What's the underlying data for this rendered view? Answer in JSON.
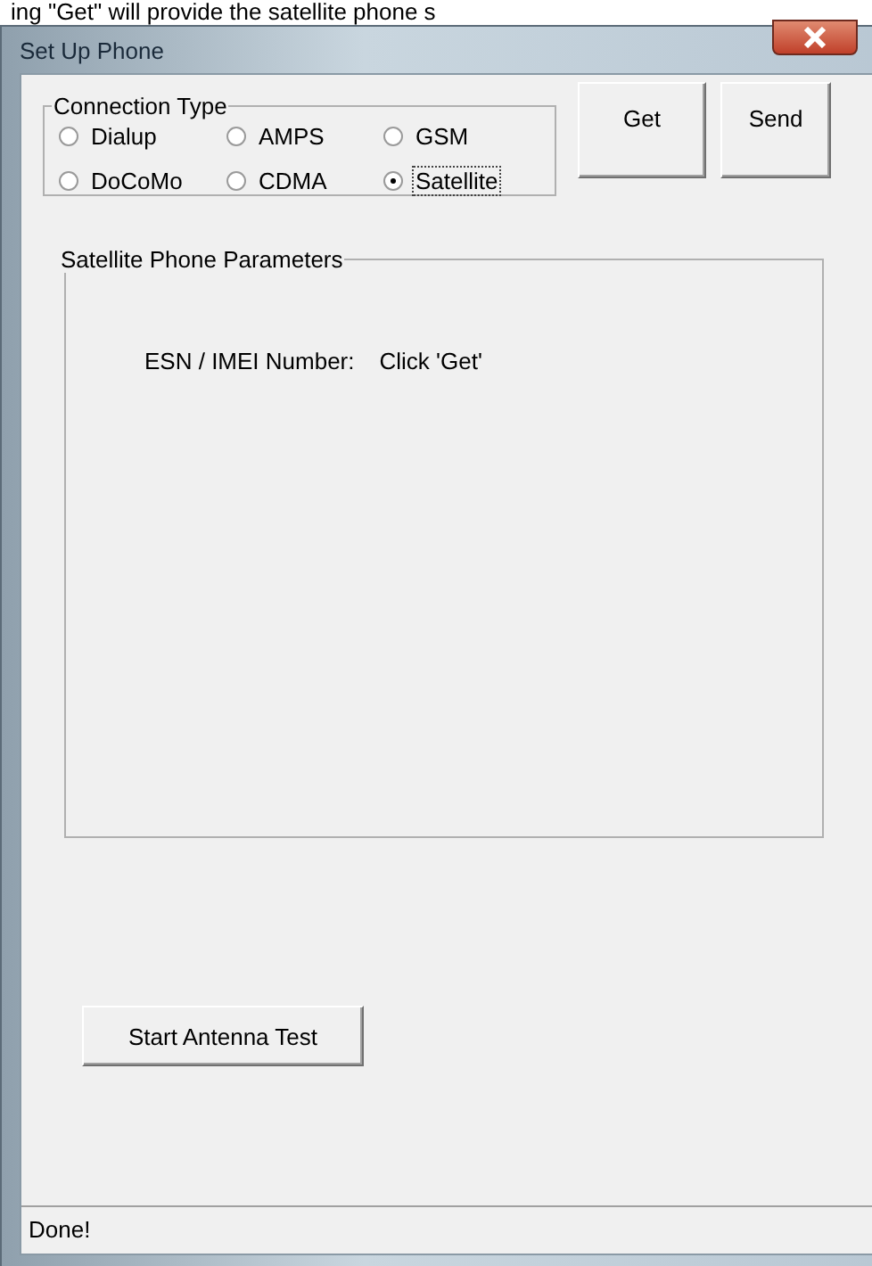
{
  "caption": "ing \"Get\" will provide the satellite phone s",
  "window": {
    "title": "Set Up Phone"
  },
  "connection_type": {
    "label": "Connection Type",
    "options": [
      {
        "label": "Dialup",
        "selected": false
      },
      {
        "label": "AMPS",
        "selected": false
      },
      {
        "label": "GSM",
        "selected": false
      },
      {
        "label": "DoCoMo",
        "selected": false
      },
      {
        "label": "CDMA",
        "selected": false
      },
      {
        "label": "Satellite",
        "selected": true
      }
    ]
  },
  "buttons": [
    "Get",
    "Send"
  ],
  "parameters": {
    "label": "Satellite Phone Parameters",
    "fields": [
      {
        "label": "ESN / IMEI Number:",
        "value": "Click 'Get'"
      }
    ]
  },
  "antenna_button": "Start Antenna Test",
  "status_bar": "Done!"
}
